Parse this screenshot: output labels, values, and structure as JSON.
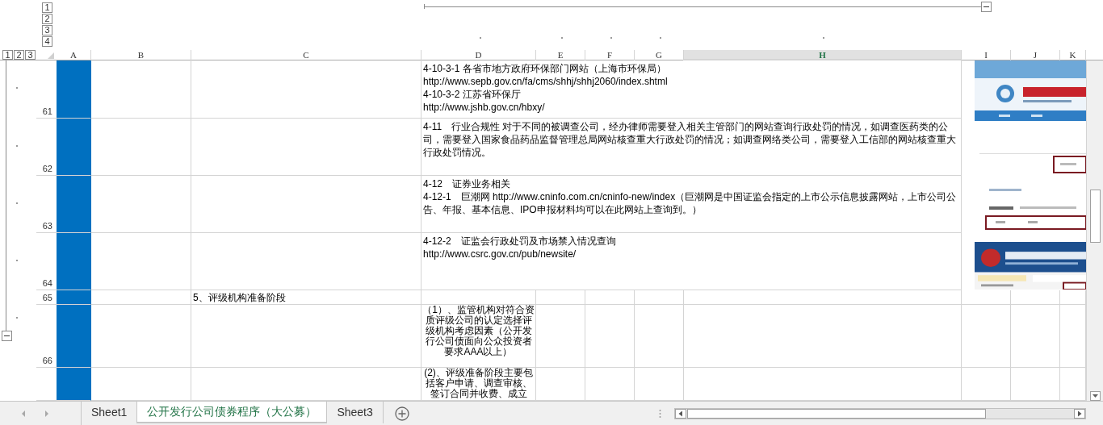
{
  "outline": {
    "column_levels": [
      "1",
      "2",
      "3",
      "4"
    ],
    "row_levels": [
      "1",
      "2",
      "3"
    ]
  },
  "columns": [
    {
      "label": "A",
      "selected": false
    },
    {
      "label": "B",
      "selected": false
    },
    {
      "label": "C",
      "selected": false
    },
    {
      "label": "D",
      "selected": false
    },
    {
      "label": "E",
      "selected": false
    },
    {
      "label": "F",
      "selected": false
    },
    {
      "label": "G",
      "selected": false
    },
    {
      "label": "H",
      "selected": true
    },
    {
      "label": "I",
      "selected": false
    },
    {
      "label": "J",
      "selected": false
    },
    {
      "label": "K",
      "selected": false
    }
  ],
  "rows": [
    {
      "number": "61",
      "kind": "wide",
      "d_lines": [
        "4-10-3-1 各省市地方政府环保部门网站（上海市环保局）",
        "http://www.sepb.gov.cn/fa/cms/shhj/shhj2060/index.shtml",
        "4-10-3-2 江苏省环保厅",
        "http://www.jshb.gov.cn/hbxy/"
      ]
    },
    {
      "number": "62",
      "kind": "wide",
      "d_lines": [
        "4-11　行业合规性 对于不同的被调查公司，经办律师需要登入相关主管部门的网站查询行政处罚的情况，如调查医药类的公司，需要登入国家食品药品监督管理总局网站核查重大行政处罚的情况；如调查网络类公司，需要登入工信部的网站核查重大行政处罚情况。"
      ]
    },
    {
      "number": "63",
      "kind": "wide",
      "d_lines": [
        "4-12　证券业务相关",
        "4-12-1　巨潮网 http://www.cninfo.com.cn/cninfo-new/index（巨潮网是中国证监会指定的上市公示信息披露网站，上市公司公告、年报、基本信息、IPO申报材料均可以在此网站上查询到。）"
      ]
    },
    {
      "number": "64",
      "kind": "wide",
      "d_lines": [
        "4-12-2　证监会行政处罚及市场禁入情况查询",
        "http://www.csrc.gov.cn/pub/newsite/"
      ]
    },
    {
      "number": "65",
      "kind": "plain",
      "c_text": "5、评级机构准备阶段"
    },
    {
      "number": "66",
      "kind": "plain",
      "d_lines": [
        "（1）、监管机构对符合资质评级公司的认定选择评级机构考虑因素（公开发行公司债面向公众投资者要求AAA以上）"
      ]
    },
    {
      "kind": "plain",
      "d_lines": [
        "(2)、评级准备阶段主要包括客户申请、调查审核、签订合同并收费、成立"
      ]
    }
  ],
  "sheet_tabs": [
    {
      "label": "Sheet1",
      "selected": false
    },
    {
      "label": "公开发行公司债券程序（大公募）",
      "selected": true
    },
    {
      "label": "Sheet3",
      "selected": false
    }
  ]
}
